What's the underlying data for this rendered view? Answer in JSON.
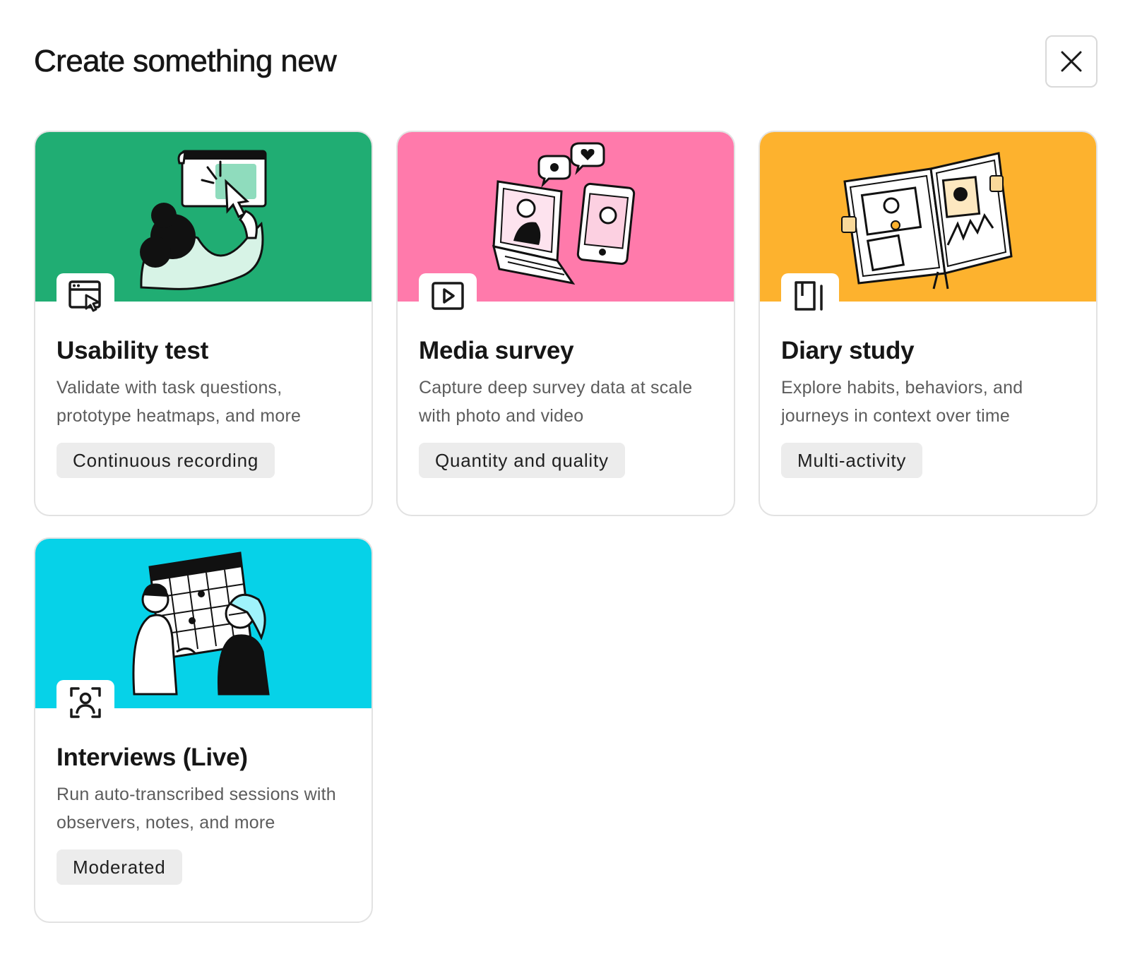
{
  "dialog": {
    "title": "Create something new",
    "close_icon": "close-icon"
  },
  "cards": [
    {
      "title": "Usability test",
      "description": "Validate with task questions, prototype heatmaps, and more",
      "tag": "Continuous recording",
      "icon": "browser-cursor-icon",
      "banner_color": "#20ad73"
    },
    {
      "title": "Media survey",
      "description": "Capture deep survey data at scale with photo and video",
      "tag": "Quantity and quality",
      "icon": "play-video-icon",
      "banner_color": "#ff7aab"
    },
    {
      "title": "Diary study",
      "description": "Explore habits, behaviors, and journeys in context over time",
      "tag": "Multi-activity",
      "icon": "notebook-icon",
      "banner_color": "#fdb22e"
    },
    {
      "title": "Interviews (Live)",
      "description": "Run auto-transcribed sessions with observers, notes, and more",
      "tag": "Moderated",
      "icon": "person-scan-icon",
      "banner_color": "#06d2e8"
    }
  ]
}
